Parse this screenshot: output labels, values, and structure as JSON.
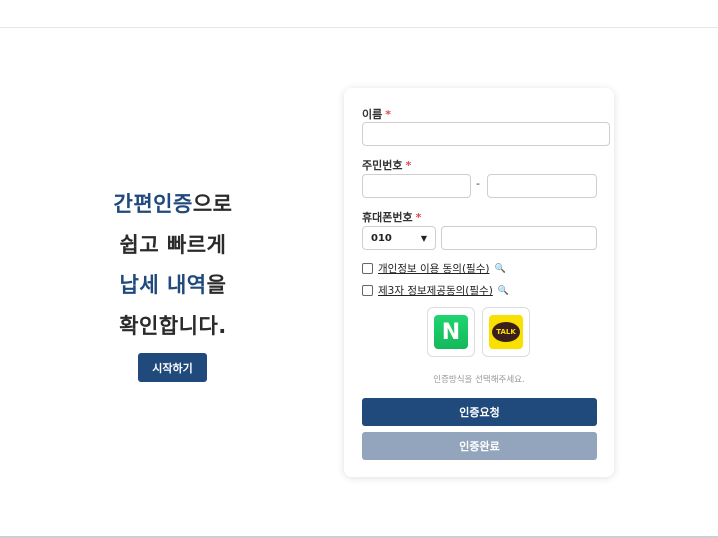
{
  "hero": {
    "line1_highlight": "간편인증",
    "line1_rest": "으로",
    "line2": "쉽고 빠르게",
    "line3_highlight": "납세 내역",
    "line3_rest": "을",
    "line4": "확인합니다.",
    "start_label": "시작하기"
  },
  "form": {
    "name_label": "이름",
    "name_value": "",
    "ssn_label": "주민번호",
    "ssn_front": "",
    "ssn_dash": "-",
    "ssn_back": "",
    "phone_label": "휴대폰번호",
    "phone_prefix": "010",
    "phone_number": "",
    "required_mark": "*",
    "agree1": "개인정보 이용 동의(필수)",
    "agree2": "제3자 정보제공동의(필수)",
    "naver_letter": "N",
    "kakao_text": "TALK",
    "hint": "인증방식을 선택해주세요.",
    "request_label": "인증요청",
    "complete_label": "인증완료"
  },
  "colors": {
    "accent": "#1f4a7b",
    "disabled": "#93a5bd",
    "required": "#e5484d",
    "naver": "#1ec864",
    "kakao": "#f9e000"
  },
  "icons": {
    "magnifier": "search-icon",
    "select_caret": "chevron-down-icon"
  }
}
